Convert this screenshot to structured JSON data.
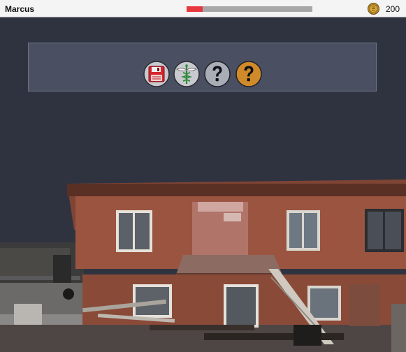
{
  "player": {
    "name": "Marcus",
    "health_fraction": 0.13,
    "health_color": "#e8383f"
  },
  "currency": {
    "icon": "gold-coin-icon",
    "amount": "200"
  },
  "actions": [
    {
      "icon": "floppy-disk-icon",
      "color": "#d6262d"
    },
    {
      "icon": "caduceus-icon",
      "color": "#2f8a3a"
    },
    {
      "icon": "question-mark-icon",
      "color": "#a9adb6"
    },
    {
      "icon": "question-mark-icon",
      "color": "#d08a2a"
    }
  ],
  "scene": {
    "sky_color": "#2f3340",
    "building_color": "#8a4a38"
  }
}
